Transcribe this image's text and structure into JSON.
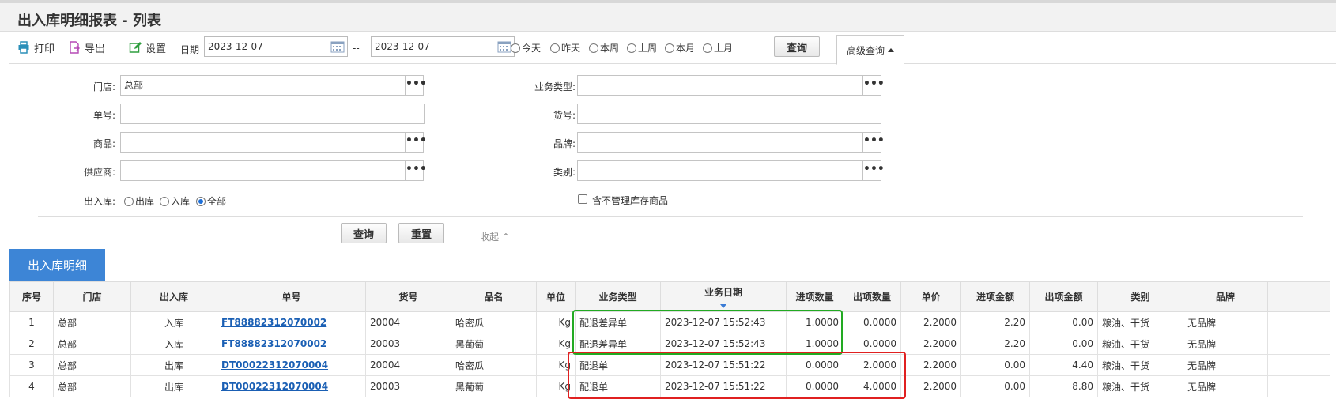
{
  "title": "出入库明细报表 - 列表",
  "toolbar": {
    "print_label": "打印",
    "export_label": "导出",
    "settings_label": "设置",
    "date_label": "日期",
    "date_from": "2023-12-07",
    "date_sep": "--",
    "date_to": "2023-12-07",
    "range_options": [
      "今天",
      "昨天",
      "本周",
      "上周",
      "本月",
      "上月"
    ],
    "query_label": "查询",
    "advanced_label": "高级查询"
  },
  "filters": {
    "store_label": "门店:",
    "store_value": "总部",
    "bill_label": "单号:",
    "bill_value": "",
    "product_label": "商品:",
    "product_value": "",
    "supplier_label": "供应商:",
    "supplier_value": "",
    "inout_label": "出入库:",
    "inout_options": [
      "出库",
      "入库",
      "全部"
    ],
    "inout_selected": "全部",
    "biztype_label": "业务类型:",
    "biztype_value": "",
    "itemno_label": "货号:",
    "itemno_value": "",
    "brand_label": "品牌:",
    "brand_value": "",
    "category_label": "类别:",
    "category_value": "",
    "exclude_label": "含不管理库存商品",
    "dots": "•••",
    "query_label": "查询",
    "reset_label": "重置",
    "collapse_label": "收起"
  },
  "section": {
    "tab_label": "出入库明细"
  },
  "table": {
    "columns": [
      "序号",
      "门店",
      "出入库",
      "单号",
      "货号",
      "品名",
      "单位",
      "业务类型",
      "业务日期",
      "进项数量",
      "出项数量",
      "单价",
      "进项金额",
      "出项金额",
      "类别",
      "品牌"
    ],
    "rows": [
      [
        "1",
        "总部",
        "入库",
        "FT88882312070002",
        "20004",
        "哈密瓜",
        "Kg",
        "配退差异单",
        "2023-12-07 15:52:43",
        "1.0000",
        "0.0000",
        "2.2000",
        "2.20",
        "0.00",
        "粮油、干货",
        "无品牌"
      ],
      [
        "2",
        "总部",
        "入库",
        "FT88882312070002",
        "20003",
        "黑葡萄",
        "Kg",
        "配退差异单",
        "2023-12-07 15:52:43",
        "1.0000",
        "0.0000",
        "2.2000",
        "2.20",
        "0.00",
        "粮油、干货",
        "无品牌"
      ],
      [
        "3",
        "总部",
        "出库",
        "DT00022312070004",
        "20004",
        "哈密瓜",
        "Kg",
        "配退单",
        "2023-12-07 15:51:22",
        "0.0000",
        "2.0000",
        "2.2000",
        "0.00",
        "4.40",
        "粮油、干货",
        "无品牌"
      ],
      [
        "4",
        "总部",
        "出库",
        "DT00022312070004",
        "20003",
        "黑葡萄",
        "Kg",
        "配退单",
        "2023-12-07 15:51:22",
        "0.0000",
        "4.0000",
        "2.2000",
        "0.00",
        "8.80",
        "粮油、干货",
        "无品牌"
      ]
    ]
  },
  "colors": {
    "accent": "#3d85d6",
    "link": "#1a5fb4",
    "highlight_green": "#22aa22",
    "highlight_red": "#e02020"
  }
}
